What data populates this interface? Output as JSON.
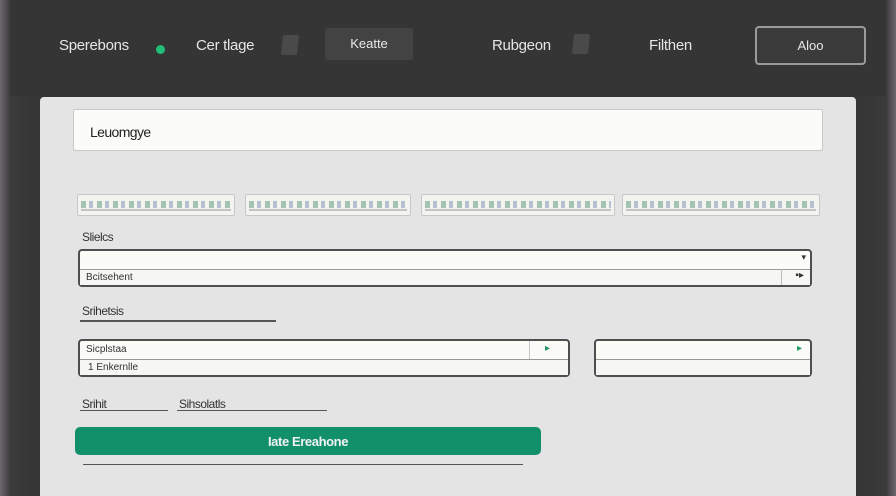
{
  "nav": {
    "item1": "Sperebons",
    "item2": "Cer tlage",
    "item3": "Keatte",
    "item4": "Rubgeon",
    "item5": "Filthen",
    "action_button": "Aloo"
  },
  "form": {
    "title_value": "Leuomgye",
    "section1_label": "Slielcs",
    "select_value": "Bcitsehent",
    "section2_label": "Srihetsis",
    "combo_left_top": "Sicplstaa",
    "combo_left_bottom": "1 Enkernlle",
    "field3_label": "Srihit",
    "field4_label": "Sihsolatls",
    "submit_label": "Iate Ereahone"
  },
  "colors": {
    "accent": "#12906a",
    "status_dot": "#1fbf7a",
    "topbar": "#353535",
    "panel": "#e4e4e4"
  }
}
